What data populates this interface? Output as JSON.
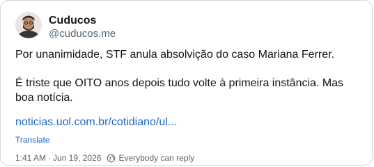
{
  "author": {
    "display_name": "Cuducos",
    "handle": "@cuducos.me"
  },
  "post": {
    "paragraph1": "Por unanimidade, STF anula absolvição do caso Mariana Ferrer.",
    "paragraph2": "É triste que OITO anos depois tudo volte à primeira instância. Mas boa notícia.",
    "link": "noticias.uol.com.br/cotidiano/ul...",
    "translate_label": "Translate"
  },
  "meta": {
    "time": "1:41 AM",
    "separator": "·",
    "date": "Jun 19, 2026",
    "reply_setting": "Everybody can reply",
    "reply_icon": "globe-icon"
  },
  "colors": {
    "link": "#1d66c9",
    "secondary_text": "#536471",
    "border": "#cfd9de"
  }
}
